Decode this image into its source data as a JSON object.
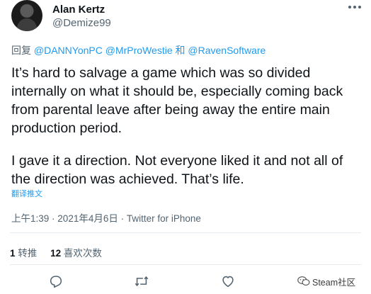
{
  "tweet": {
    "display_name": "Alan Kertz",
    "handle": "@Demize99",
    "reply_prefix": "回复",
    "mentions": [
      "@DANNYonPC",
      "@MrProWestie",
      "@RavenSoftware"
    ],
    "mention_joiner": "和",
    "text_lines": [
      "It’s hard to salvage a game which was so divided",
      "internally on what it should be, especially coming back",
      "from parental leave after being away the entire main",
      "production period.",
      "",
      "I gave it a direction. Not everyone liked it and not all of",
      "the direction was achieved. That’s life."
    ],
    "translate_label": "翻译推文",
    "time": "上午1:39",
    "date": "2021年4月6日",
    "source": "Twitter for iPhone",
    "retweets": {
      "count": "1",
      "label": "转推"
    },
    "likes": {
      "count": "12",
      "label": "喜欢次数"
    }
  },
  "icons": {
    "more": "more-dots-icon",
    "reply": "reply-icon",
    "retweet": "retweet-icon",
    "like": "heart-icon",
    "share": "share-icon"
  },
  "watermark": {
    "text": "Steam社区"
  },
  "colors": {
    "link": "#1d9bf0",
    "secondary": "#536471",
    "text": "#0f1419",
    "divider": "#e6ecf0"
  }
}
